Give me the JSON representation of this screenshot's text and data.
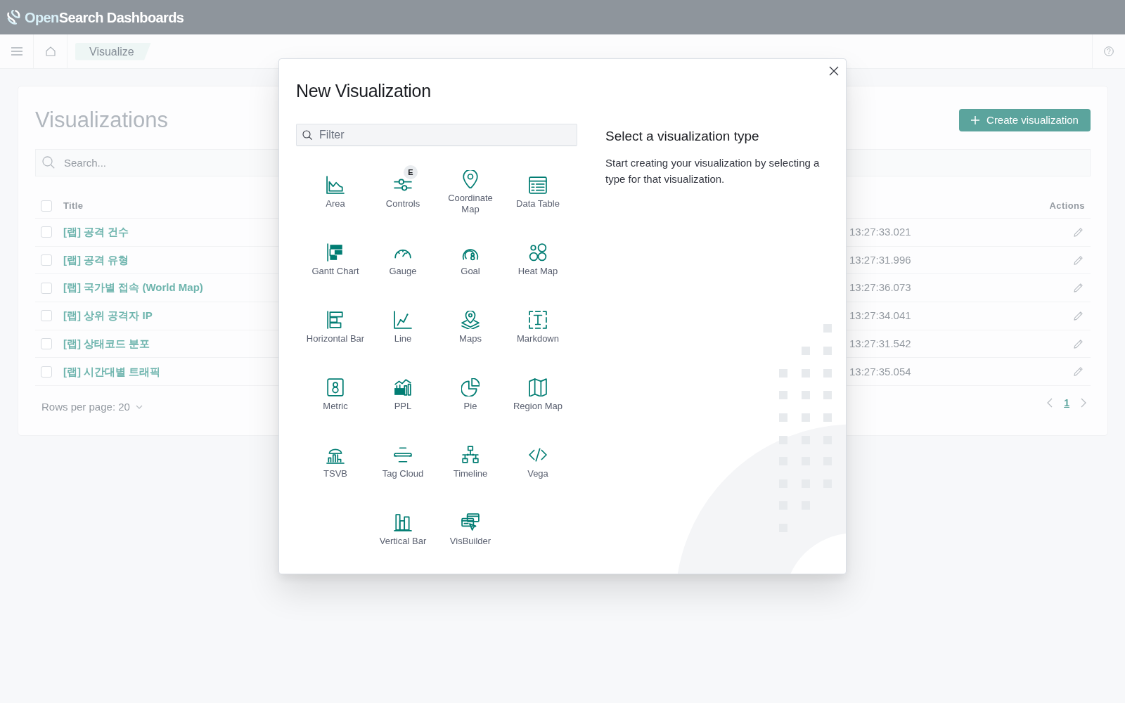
{
  "header": {
    "logo": [
      {
        "text": "Open",
        "accent": true
      },
      {
        "text": "Search Dashboards",
        "accent": false
      }
    ]
  },
  "nav": {
    "breadcrumb": "Visualize"
  },
  "page": {
    "title": "Visualizations",
    "create_button": "Create visualization",
    "search": {
      "placeholder": "Search..."
    },
    "table": {
      "columns": [
        "Title",
        "Actions"
      ],
      "header_checked": false,
      "rows": [
        {
          "title": "[랩] 공격 건수",
          "time": "13:27:33.021",
          "checked": false
        },
        {
          "title": "[랩] 공격 유형",
          "time": "13:27:31.996",
          "checked": false
        },
        {
          "title": "[랩] 국가별 접속 (World Map)",
          "time": "13:27:36.073",
          "checked": false
        },
        {
          "title": "[랩] 상위 공격자 IP",
          "time": "13:27:34.041",
          "checked": false
        },
        {
          "title": "[랩] 상태코드 분포",
          "time": "13:27:31.542",
          "checked": false
        },
        {
          "title": "[랩] 시간대별 트래픽",
          "time": "13:27:35.054",
          "checked": false
        }
      ]
    },
    "rows_per_page": "Rows per page: 20",
    "pagination": [
      {
        "label": "1",
        "selected": true
      }
    ]
  },
  "modal": {
    "title": "New Visualization",
    "filter": {
      "placeholder": "Filter"
    },
    "types": [
      {
        "label": "Area",
        "kind": "area"
      },
      {
        "label": "Controls",
        "kind": "controls",
        "badge": "E"
      },
      {
        "label": "Coordinate Map",
        "kind": "coordinate_map"
      },
      {
        "label": "Data Table",
        "kind": "data_table"
      },
      {
        "label": "Gantt Chart",
        "kind": "gantt"
      },
      {
        "label": "Gauge",
        "kind": "gauge"
      },
      {
        "label": "Goal",
        "kind": "goal"
      },
      {
        "label": "Heat Map",
        "kind": "heat_map"
      },
      {
        "label": "Horizontal Bar",
        "kind": "horizontal_bar"
      },
      {
        "label": "Line",
        "kind": "line"
      },
      {
        "label": "Maps",
        "kind": "maps"
      },
      {
        "label": "Markdown",
        "kind": "markdown"
      },
      {
        "label": "Metric",
        "kind": "metric"
      },
      {
        "label": "PPL",
        "kind": "ppl"
      },
      {
        "label": "Pie",
        "kind": "pie"
      },
      {
        "label": "Region Map",
        "kind": "region_map"
      },
      {
        "label": "TSVB",
        "kind": "tsvb"
      },
      {
        "label": "Tag Cloud",
        "kind": "tag_cloud"
      },
      {
        "label": "Timeline",
        "kind": "timeline"
      },
      {
        "label": "Vega",
        "kind": "vega"
      },
      {
        "label": "Vertical Bar",
        "kind": "vertical_bar"
      },
      {
        "label": "VisBuilder",
        "kind": "visbuilder"
      }
    ],
    "info": {
      "title": "Select a visualization type",
      "text": "Start creating your visualization by selecting a type for that visualization."
    }
  }
}
